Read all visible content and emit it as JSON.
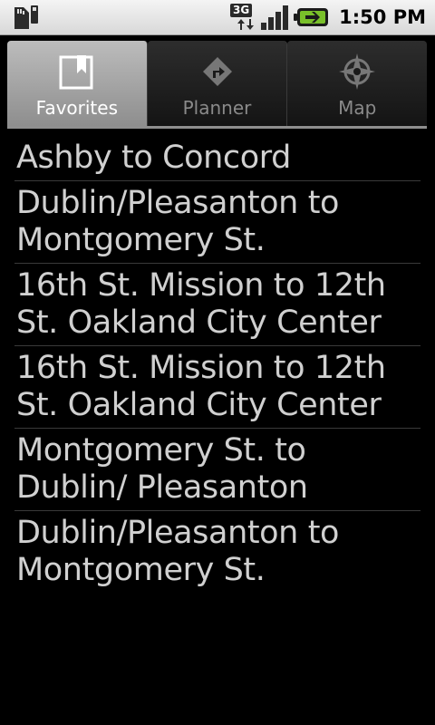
{
  "status_bar": {
    "network_type": "3G",
    "time": "1:50 PM",
    "colors": {
      "battery": "#79c02a"
    }
  },
  "tabs": [
    {
      "label": "Favorites",
      "icon": "bookmark-icon",
      "selected": true
    },
    {
      "label": "Planner",
      "icon": "directions-icon",
      "selected": false
    },
    {
      "label": "Map",
      "icon": "compass-icon",
      "selected": false
    }
  ],
  "favorites": [
    "Ashby to Concord",
    "Dublin/Pleasanton to Montgomery St.",
    "16th St. Mission to 12th St. Oakland City Center",
    "16th St. Mission to 12th St. Oakland City Center",
    "Montgomery St. to Dublin/ Pleasanton",
    "Dublin/Pleasanton to Montgomery St."
  ]
}
